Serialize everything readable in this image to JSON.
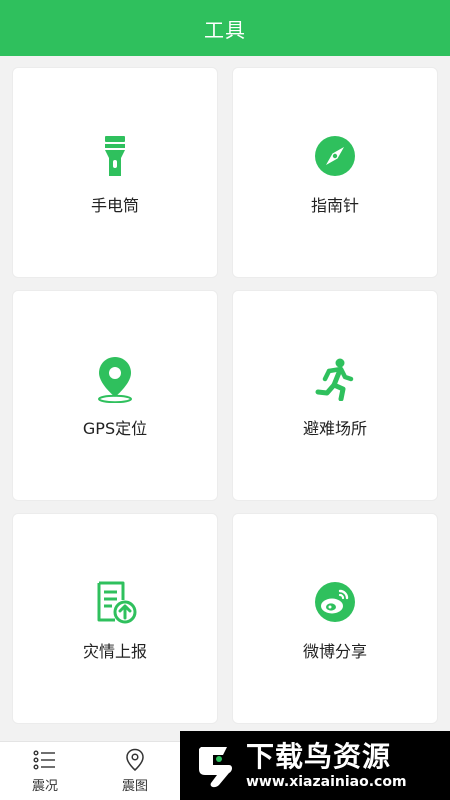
{
  "header": {
    "title": "工具"
  },
  "colors": {
    "accent": "#2fc05d",
    "background": "#f2f2f2",
    "card": "#ffffff"
  },
  "tools": [
    {
      "label": "手电筒",
      "icon": "flashlight-icon"
    },
    {
      "label": "指南针",
      "icon": "compass-icon"
    },
    {
      "label": "GPS定位",
      "icon": "location-pin-icon"
    },
    {
      "label": "避难场所",
      "icon": "running-person-icon"
    },
    {
      "label": "灾情上报",
      "icon": "report-upload-icon"
    },
    {
      "label": "微博分享",
      "icon": "weibo-icon"
    }
  ],
  "tabbar": {
    "items": [
      {
        "label": "震况",
        "icon": "list-icon"
      },
      {
        "label": "震图",
        "icon": "map-pin-outline-icon"
      }
    ]
  },
  "watermark": {
    "title": "下载鸟资源",
    "url": "www.xiazainiao.com"
  }
}
